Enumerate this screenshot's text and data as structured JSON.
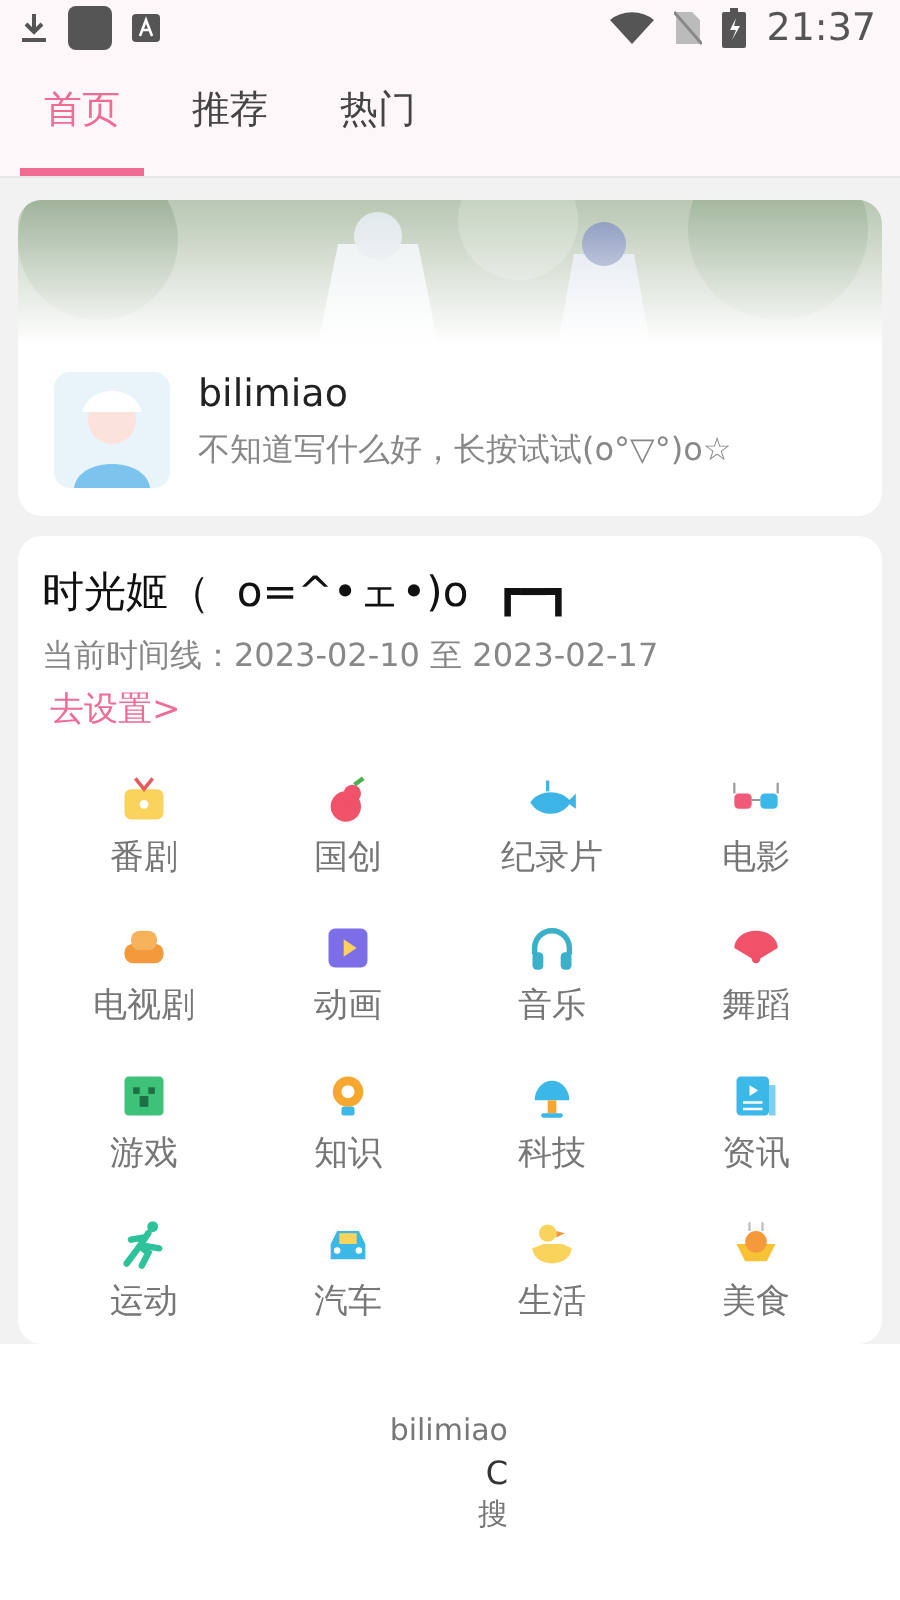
{
  "status_bar": {
    "time": "21:37"
  },
  "tabs": [
    {
      "label": "首页",
      "selected": true
    },
    {
      "label": "推荐",
      "selected": false
    },
    {
      "label": "热门",
      "selected": false
    }
  ],
  "profile_card": {
    "name": "bilimiao",
    "signature": "不知道写什么好，长按试试(o°▽°)o☆"
  },
  "timeline_card": {
    "title": "时光姬（  o=^•ェ•)o  ┏━┓",
    "timeline": "当前时间线：2023-02-10 至 2023-02-17",
    "settings_link": "去设置>"
  },
  "categories": [
    {
      "label": "番剧"
    },
    {
      "label": "国创"
    },
    {
      "label": "纪录片"
    },
    {
      "label": "电影"
    },
    {
      "label": "电视剧"
    },
    {
      "label": "动画"
    },
    {
      "label": "音乐"
    },
    {
      "label": "舞蹈"
    },
    {
      "label": "游戏"
    },
    {
      "label": "知识"
    },
    {
      "label": "科技"
    },
    {
      "label": "资讯"
    },
    {
      "label": "运动"
    },
    {
      "label": "汽车"
    },
    {
      "label": "生活"
    },
    {
      "label": "美食"
    }
  ],
  "bottom_bar": {
    "app_name": "bilimiao",
    "line_2": "C",
    "line_3": "搜"
  }
}
